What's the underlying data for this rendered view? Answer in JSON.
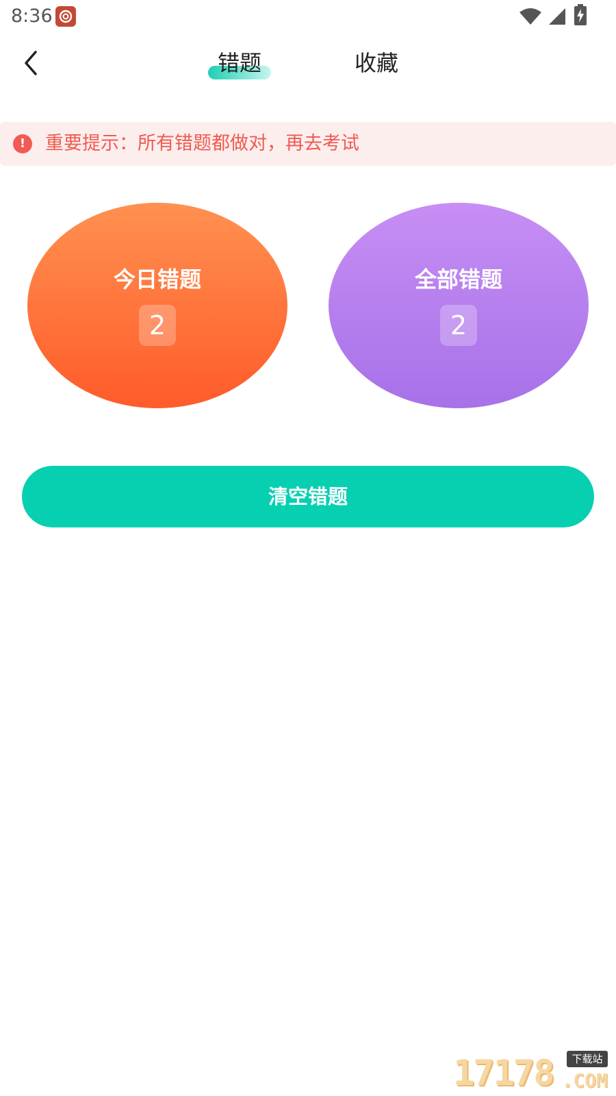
{
  "status_bar": {
    "time": "8:36"
  },
  "header": {
    "tabs": [
      {
        "label": "错题",
        "active": true
      },
      {
        "label": "收藏",
        "active": false
      }
    ]
  },
  "notice": {
    "icon_glyph": "!",
    "text": "重要提示：所有错题都做对，再去考试"
  },
  "stats": {
    "today": {
      "title": "今日错题",
      "count": "2"
    },
    "all": {
      "title": "全部错题",
      "count": "2"
    }
  },
  "actions": {
    "clear_label": "清空错题"
  },
  "watermark": {
    "digits": "17178",
    "tag": "下载站",
    "suffix": ".COM"
  },
  "colors": {
    "accent": "#07d0b1",
    "warning": "#ef5b50",
    "today_gradient_top": "#ff9150",
    "today_gradient_bottom": "#ff5b2a",
    "all_gradient_top": "#c78ef4",
    "all_gradient_bottom": "#a771e8"
  },
  "icons": {
    "back": "chevron-left-icon",
    "notification": "app-notification-icon",
    "wifi": "wifi-icon",
    "signal": "cell-signal-icon",
    "battery": "battery-charging-icon",
    "notice": "exclamation-icon"
  }
}
